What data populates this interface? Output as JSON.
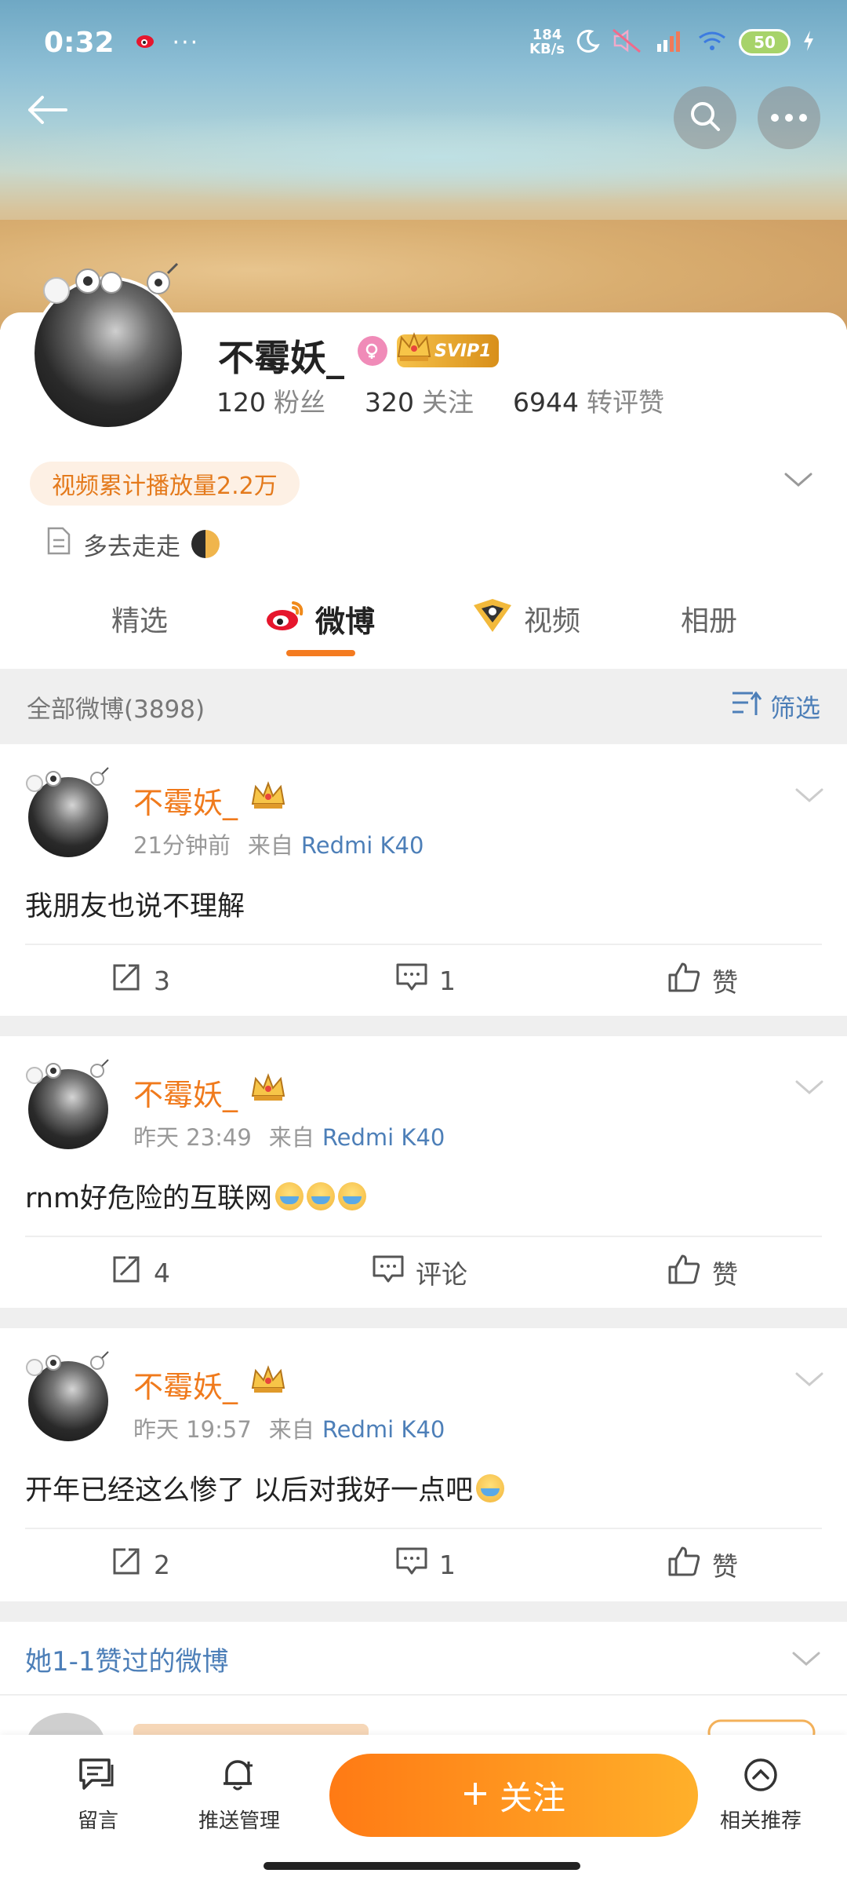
{
  "status_bar": {
    "time": "0:32",
    "dots": "···",
    "speed_value": "184",
    "speed_unit": "KB/s",
    "battery": "50"
  },
  "profile": {
    "name": "不霉妖_",
    "vip": "SVIP1",
    "stats": [
      {
        "num": "120",
        "label": "粉丝"
      },
      {
        "num": "320",
        "label": "关注"
      },
      {
        "num": "6944",
        "label": "转评赞"
      }
    ],
    "views_badge": "视频累计播放量2.2万",
    "bio": "多去走走"
  },
  "tabs": [
    {
      "label": "精选"
    },
    {
      "label": "微博"
    },
    {
      "label": "视频"
    },
    {
      "label": "相册"
    }
  ],
  "feed": {
    "header": "全部微博(3898)",
    "filter": "筛选"
  },
  "posts": [
    {
      "author": "不霉妖_",
      "time": "21分钟前",
      "from_label": "来自",
      "source": "Redmi K40",
      "text": "我朋友也说不理解",
      "emoji_count": 0,
      "reposts": "3",
      "comments": "1",
      "likes": "赞"
    },
    {
      "author": "不霉妖_",
      "time": "昨天 23:49",
      "from_label": "来自",
      "source": "Redmi K40",
      "text": "rnm好危险的互联网",
      "emoji_count": 3,
      "reposts": "4",
      "comments": "评论",
      "likes": "赞"
    },
    {
      "author": "不霉妖_",
      "time": "昨天 19:57",
      "from_label": "来自",
      "source": "Redmi K40",
      "text": "开年已经这么惨了  以后对我好一点吧",
      "emoji_count": 1,
      "reposts": "2",
      "comments": "1",
      "likes": "赞"
    }
  ],
  "liked_section": {
    "title": "她1-1赞过的微博"
  },
  "bottom_bar": {
    "message": "留言",
    "push": "推送管理",
    "follow": "关注",
    "related": "相关推荐"
  },
  "colors": {
    "accent": "#f47b20",
    "link": "#4d7fb8",
    "follow_start": "#ff7a14",
    "follow_end": "#ffb02a"
  }
}
